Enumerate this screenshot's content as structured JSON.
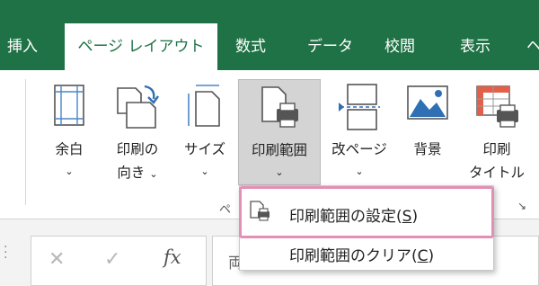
{
  "tabs": [
    {
      "label": "挿入"
    },
    {
      "label": "ページ レイアウト"
    },
    {
      "label": "数式"
    },
    {
      "label": "データ"
    },
    {
      "label": "校閲"
    },
    {
      "label": "表示"
    },
    {
      "label": "ヘ"
    }
  ],
  "ribbon": {
    "margin": {
      "line1": "余白",
      "chevron": "⌄"
    },
    "orientation": {
      "line1": "印刷の",
      "line2": "向き",
      "chevron": "⌄"
    },
    "size": {
      "line1": "サイズ",
      "chevron": "⌄"
    },
    "print_area": {
      "line1": "印刷範囲",
      "chevron": "⌄"
    },
    "breaks": {
      "line1": "改ページ",
      "chevron": "⌄"
    },
    "background": {
      "line1": "背景"
    },
    "print_titles": {
      "line1": "印刷",
      "line2": "タイトル"
    },
    "group_fragment": "ペ",
    "launcher": "↘"
  },
  "formula_bar": {
    "cancel": "✕",
    "enter": "✓",
    "fx": "fx",
    "content_fragment": "両"
  },
  "menu": {
    "set_print_area": {
      "text": "印刷範囲の設定(",
      "key": "S",
      "close": ")"
    },
    "clear_print_area": {
      "text": "印刷範囲のクリア(",
      "key": "C",
      "close": ")"
    }
  },
  "colors": {
    "tab_bar": "#1f7245",
    "highlight": "#e48fb5",
    "selected_button": "#d4d4d4"
  }
}
